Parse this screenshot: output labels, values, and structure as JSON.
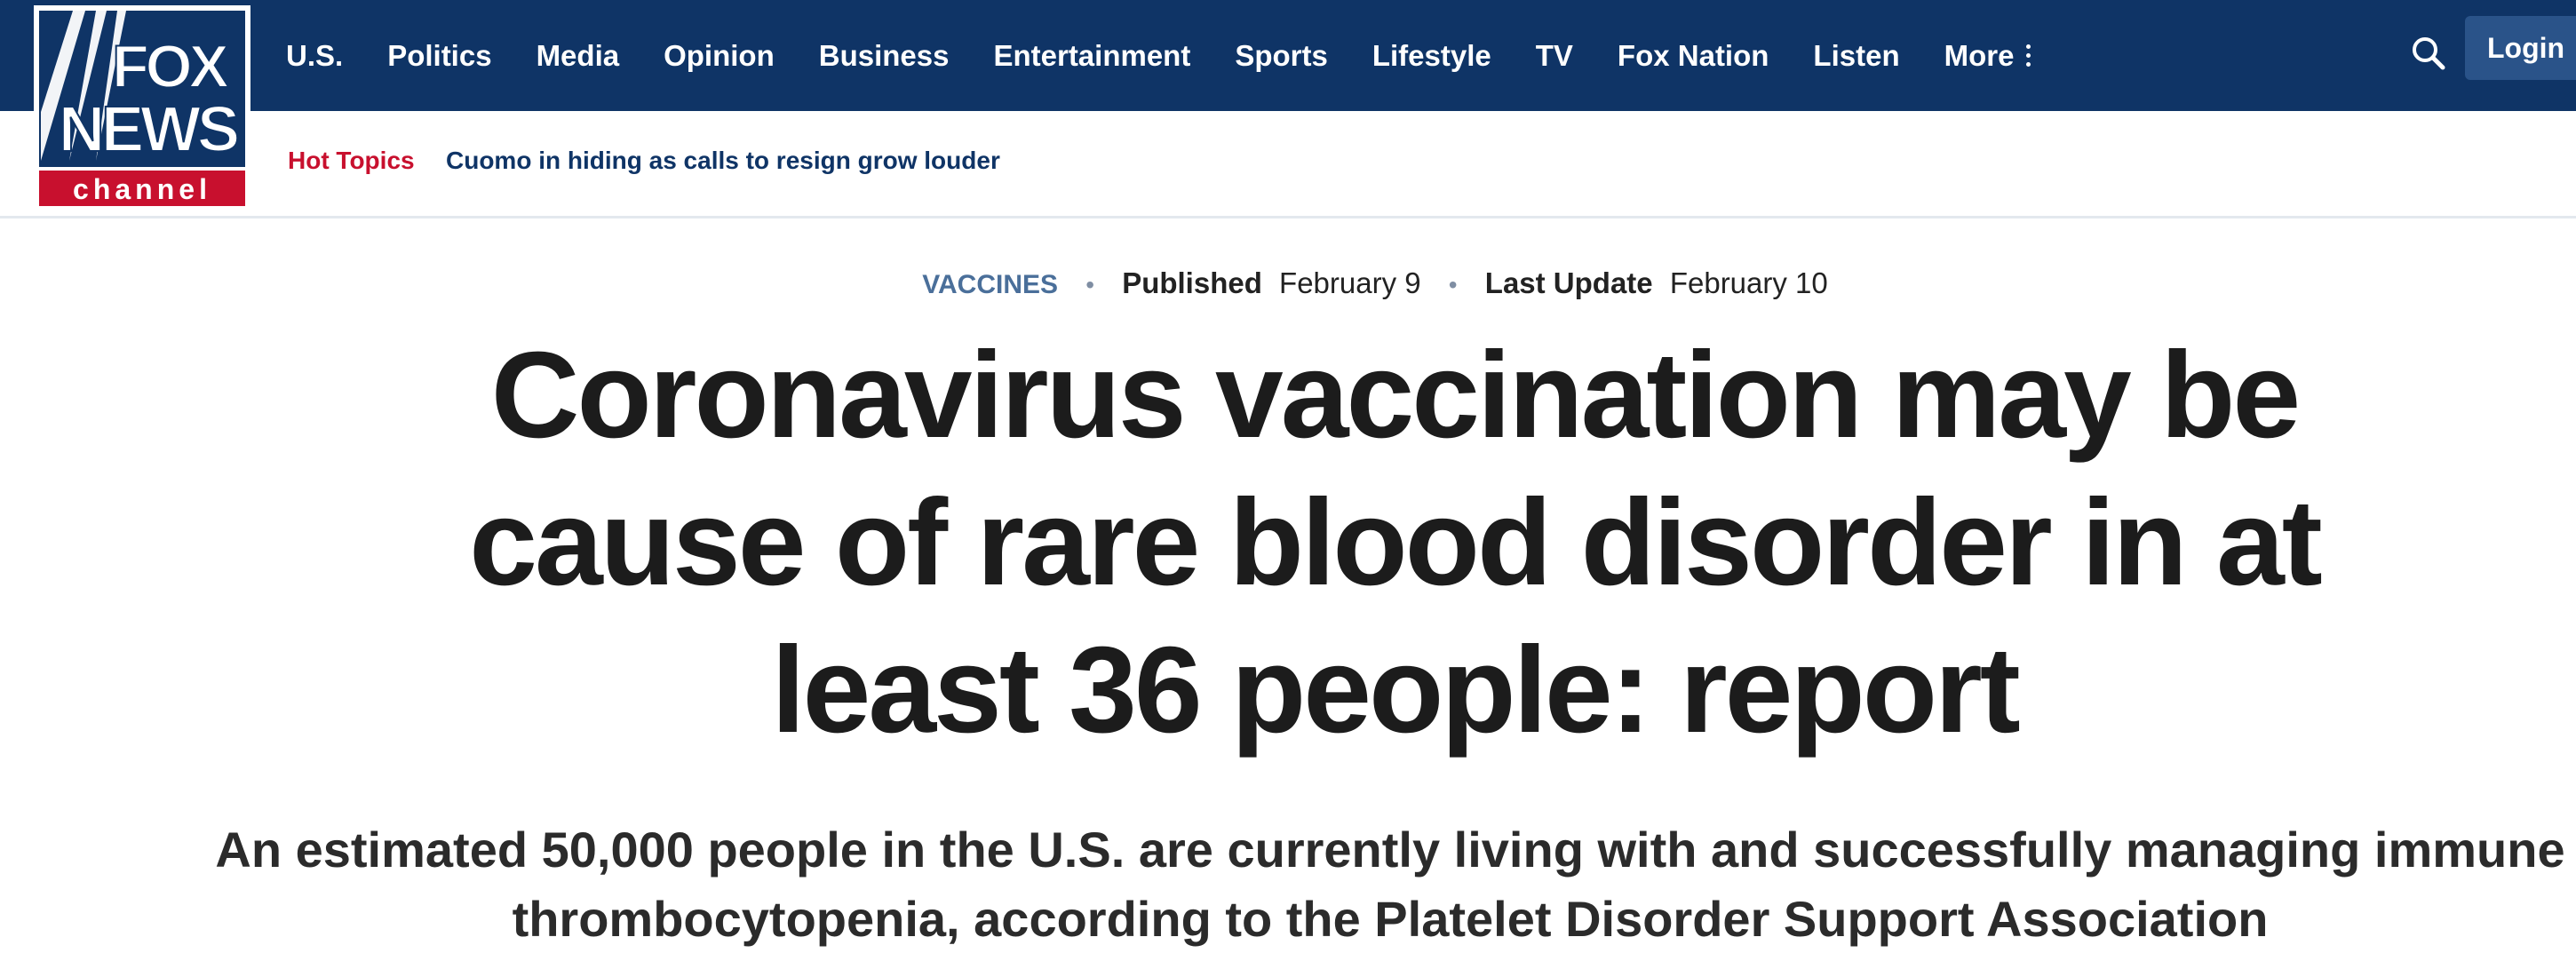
{
  "brand": {
    "logo_text_line1": "FOX",
    "logo_text_line2": "NEWS",
    "logo_text_line3": "channel",
    "colors": {
      "navy": "#0f3466",
      "red": "#c8102e",
      "login_bg": "#2a5389",
      "eyebrow": "#4a6f9a"
    }
  },
  "nav": {
    "items": [
      {
        "label": "U.S."
      },
      {
        "label": "Politics"
      },
      {
        "label": "Media"
      },
      {
        "label": "Opinion"
      },
      {
        "label": "Business"
      },
      {
        "label": "Entertainment"
      },
      {
        "label": "Sports"
      },
      {
        "label": "Lifestyle"
      },
      {
        "label": "TV"
      },
      {
        "label": "Fox Nation"
      },
      {
        "label": "Listen"
      },
      {
        "label": "More"
      }
    ],
    "search_icon": "search-icon",
    "more_icon": "vertical-dots-icon",
    "login_label": "Login"
  },
  "hot_topics": {
    "label": "Hot Topics",
    "items": [
      {
        "label": "Cuomo in hiding as calls to resign grow louder"
      }
    ]
  },
  "article": {
    "category": "VACCINES",
    "published_label": "Published",
    "published_date": "February 9",
    "updated_label": "Last Update",
    "updated_date": "February 10",
    "separator": "•",
    "headline": "Coronavirus vaccination may be cause of rare blood disorder in at least 36 people: report",
    "subheadline": "An estimated 50,000 people in the U.S. are currently living with and successfully managing immune thrombocytopenia, according to the Platelet Disorder Support Association"
  }
}
